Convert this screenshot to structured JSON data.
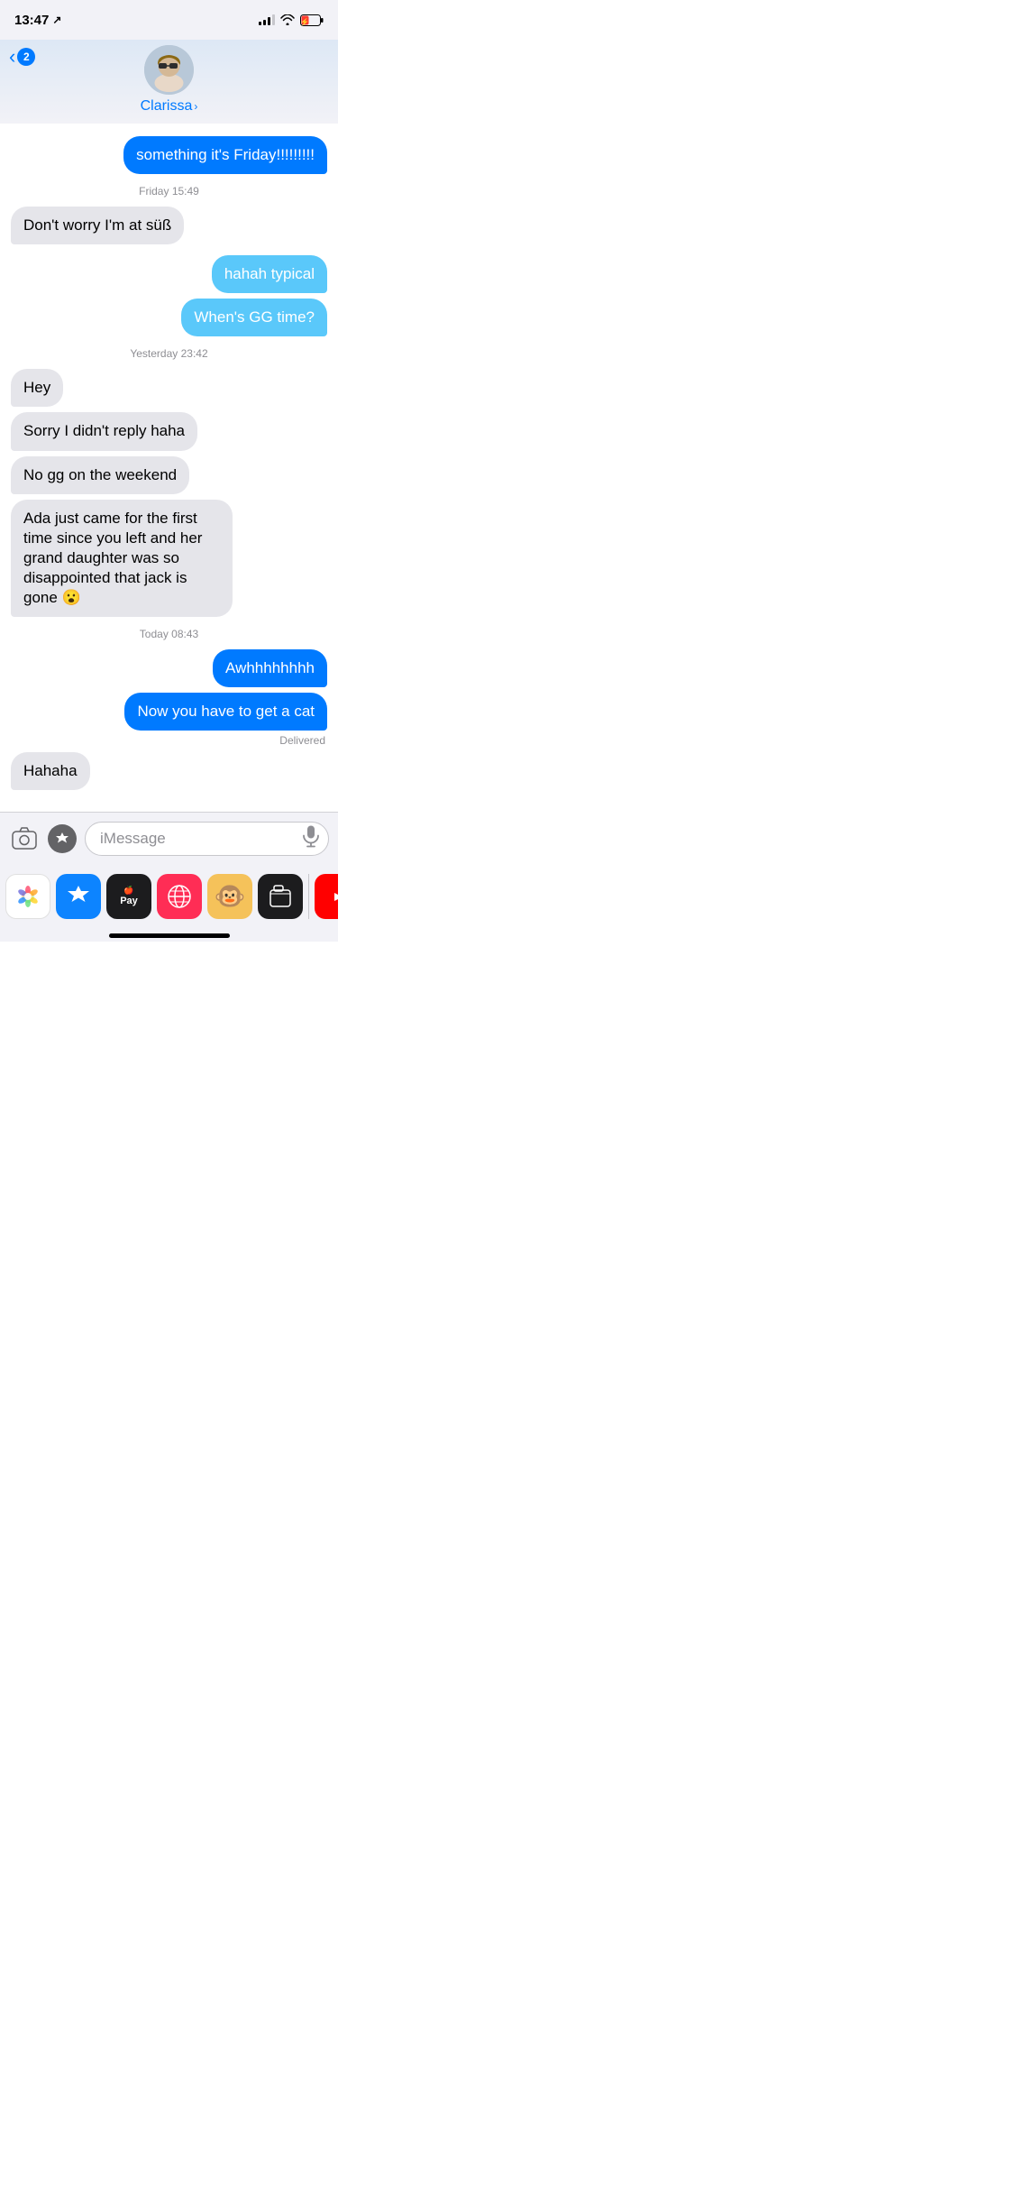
{
  "statusBar": {
    "time": "13:47",
    "locationIcon": "↗"
  },
  "header": {
    "backLabel": "2",
    "contactName": "Clarissa",
    "chevron": "›"
  },
  "messages": [
    {
      "id": "msg1",
      "type": "sent-partial",
      "text": "something it's Friday!!!!!!!!!",
      "color": "blue"
    },
    {
      "id": "ts1",
      "type": "timestamp",
      "text": "Friday 15:49"
    },
    {
      "id": "msg2",
      "type": "received",
      "text": "Don't worry I'm at süß"
    },
    {
      "id": "msg3",
      "type": "sent",
      "text": "hahah typical"
    },
    {
      "id": "msg4",
      "type": "sent",
      "text": "When's GG time?"
    },
    {
      "id": "ts2",
      "type": "timestamp",
      "text": "Yesterday 23:42"
    },
    {
      "id": "msg5",
      "type": "received",
      "text": "Hey"
    },
    {
      "id": "msg6",
      "type": "received",
      "text": "Sorry I didn't reply haha"
    },
    {
      "id": "msg7",
      "type": "received",
      "text": "No gg on the weekend"
    },
    {
      "id": "msg8",
      "type": "received",
      "text": "Ada just came for the first time since you left and her grand daughter was so disappointed that jack is gone 😮"
    },
    {
      "id": "ts3",
      "type": "timestamp",
      "text": "Today 08:43"
    },
    {
      "id": "msg9",
      "type": "sent",
      "text": "Awhhhhhhhh"
    },
    {
      "id": "msg10",
      "type": "sent",
      "text": "Now you have to get a cat"
    },
    {
      "id": "delivered",
      "type": "delivered",
      "text": "Delivered"
    },
    {
      "id": "msg11",
      "type": "received",
      "text": "Hahaha"
    }
  ],
  "inputBar": {
    "placeholder": "iMessage"
  },
  "dock": {
    "apps": [
      {
        "name": "Photos",
        "bg": "white"
      },
      {
        "name": "App Store",
        "bg": "#0d84ff"
      },
      {
        "name": "Apple Pay",
        "bg": "#1c1c1e"
      },
      {
        "name": "Browser",
        "bg": "#ff2d55"
      },
      {
        "name": "Monkey",
        "bg": "#f5c25a"
      },
      {
        "name": "Files",
        "bg": "#1c1c1e"
      },
      {
        "name": "YouTube",
        "bg": "#ff0000"
      }
    ]
  }
}
